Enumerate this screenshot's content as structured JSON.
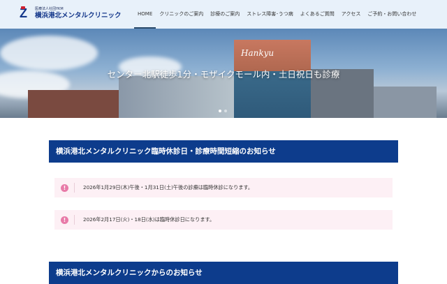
{
  "header": {
    "logo": {
      "sub": "医療法人社団YKM",
      "name": "横浜港北メンタルクリニック"
    },
    "nav": [
      {
        "label": "HOME",
        "active": true
      },
      {
        "label": "クリニックのご案内"
      },
      {
        "label": "診療のご案内"
      },
      {
        "label": "ストレス障害･うつ病"
      },
      {
        "label": "よくあるご質問"
      },
      {
        "label": "アクセス"
      },
      {
        "label": "ご予約・お問い合わせ"
      }
    ]
  },
  "hero": {
    "caption": "センター北駅徒歩1分・モザイクモール内・土日祝日も診療",
    "sign": "Hankyu"
  },
  "sections": [
    {
      "title": "横浜港北メンタルクリニック臨時休診日・診療時間短縮のお知らせ",
      "notices": [
        "2026年1月29日(木)午後・1月31日(土)午後の診療は臨時休診になります。",
        "2026年2月17日(火)・18日(水)は臨時休診日になります。"
      ]
    },
    {
      "title": "横浜港北メンタルクリニックからのお知らせ"
    }
  ],
  "colors": {
    "header_bg": "#e8f1fa",
    "title_bg": "#0d3c8c",
    "notice_bg": "#fdf0f5",
    "notice_icon": "#e87aa8"
  }
}
